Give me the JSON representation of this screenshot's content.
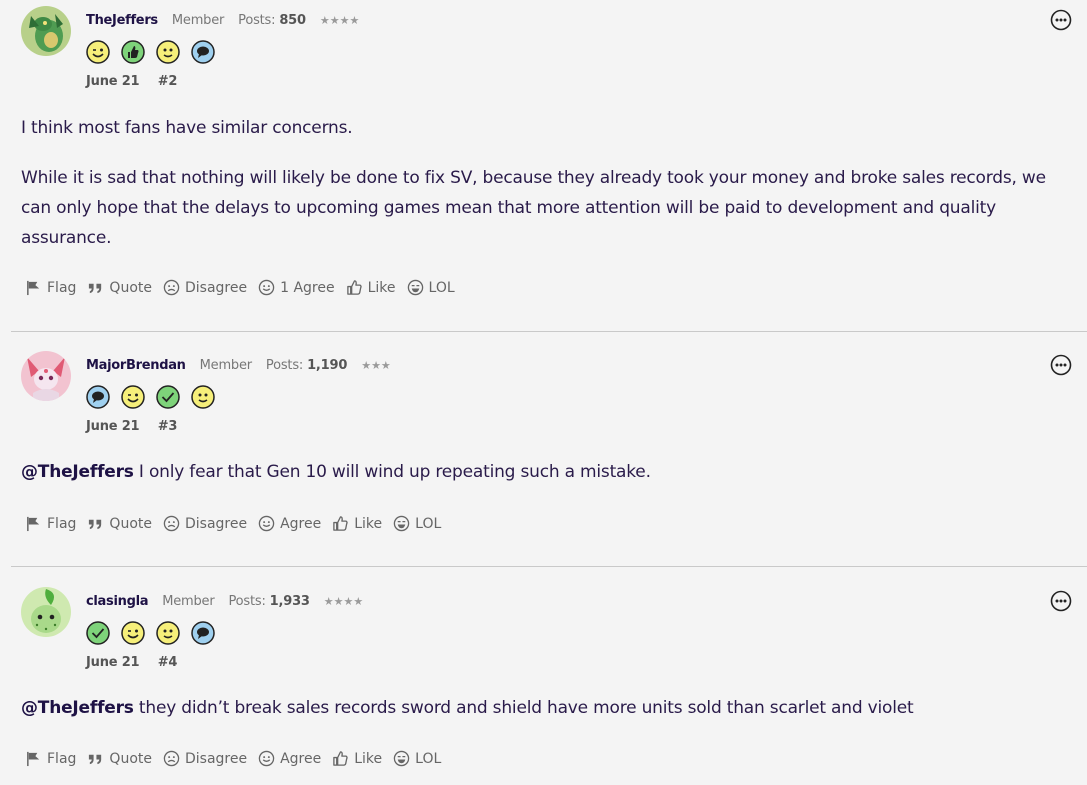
{
  "posts": [
    {
      "username": "TheJeffers",
      "role": "Member",
      "posts_label": "Posts:",
      "posts_count": "850",
      "stars": "★★★★",
      "date": "June 21",
      "post_number": "#2",
      "avatar": "green-dragon-avatar",
      "badges": [
        "wink-face-icon",
        "thumbs-up-icon",
        "smile-face-icon",
        "speech-bubble-icon"
      ],
      "body": [
        "I think most fans have similar concerns.",
        "While it is sad that nothing will likely be done to fix SV, because they already took your money and broke sales records, we can only hope that the delays to upcoming games mean that more attention will be paid to development and quality assurance."
      ],
      "mention": "",
      "actions": [
        "Flag",
        "Quote",
        "Disagree",
        "1 Agree",
        "Like",
        "LOL"
      ]
    },
    {
      "username": "MajorBrendan",
      "role": "Member",
      "posts_label": "Posts:",
      "posts_count": "1,190",
      "stars": "★★★",
      "date": "June 21",
      "post_number": "#3",
      "avatar": "pink-creature-avatar",
      "badges": [
        "speech-bubble-icon",
        "wink-face-icon",
        "checkmark-icon",
        "smile-face-icon"
      ],
      "mention": "@TheJeffers",
      "body": [
        " I only fear that Gen 10 will wind up repeating such a mistake."
      ],
      "actions": [
        "Flag",
        "Quote",
        "Disagree",
        "Agree",
        "Like",
        "LOL"
      ]
    },
    {
      "username": "clasingla",
      "role": "Member",
      "posts_label": "Posts:",
      "posts_count": "1,933",
      "stars": "★★★★",
      "date": "June 21",
      "post_number": "#4",
      "avatar": "leaf-creature-avatar",
      "badges": [
        "checkmark-icon",
        "wink-face-icon",
        "smile-face-icon",
        "speech-bubble-icon"
      ],
      "mention": "@TheJeffers",
      "body": [
        " they didn’t break sales records sword and shield have more units sold than scarlet and violet"
      ],
      "actions": [
        "Flag",
        "Quote",
        "Disagree",
        "Agree",
        "Like",
        "LOL"
      ]
    }
  ],
  "colors": {
    "background": "#f4f4f4",
    "text": "#2a1b4a",
    "muted": "#666666",
    "divider": "#c9c9c9",
    "badge_yellow": "#f6ef7a",
    "badge_green": "#7ed37a",
    "badge_blue": "#9fd0ef"
  }
}
